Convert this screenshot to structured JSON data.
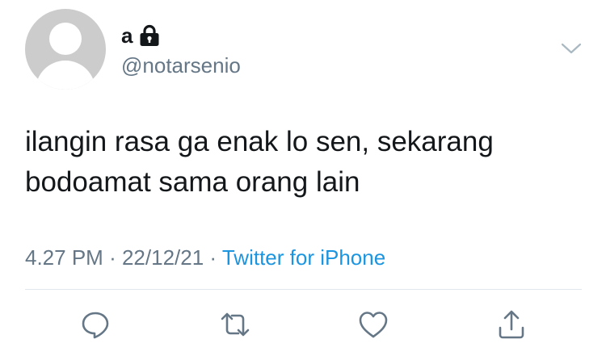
{
  "tweet": {
    "display_name": "a",
    "handle": "@notarsenio",
    "text_lines": [
      "ilangin rasa ga enak lo sen, sekarang",
      "bodoamat sama orang lain"
    ],
    "time": "4.27 PM",
    "date": "22/12/21",
    "separator": "·",
    "source": "Twitter for iPhone"
  },
  "icons": {
    "lock": "lock-icon",
    "menu": "chevron-down-icon",
    "reply": "reply-icon",
    "retweet": "retweet-icon",
    "like": "heart-icon",
    "share": "share-icon"
  },
  "colors": {
    "text": "#14171a",
    "secondary": "#657786",
    "link": "#1b95e0",
    "icon": "#657786",
    "divider": "#e1e8ed",
    "avatar_bg": "#cccccc"
  }
}
